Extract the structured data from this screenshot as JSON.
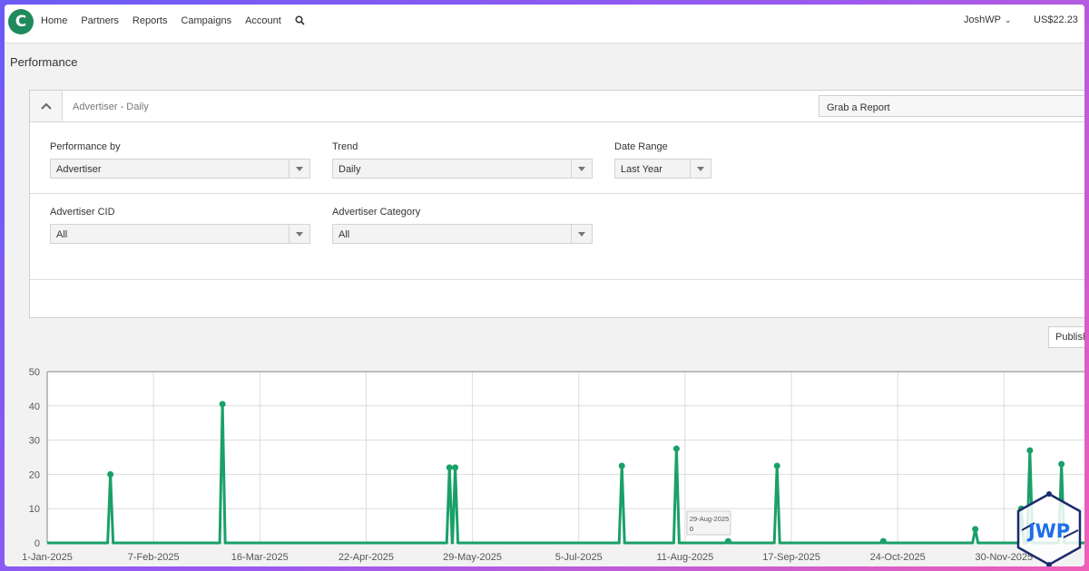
{
  "nav": {
    "links": [
      "Home",
      "Partners",
      "Reports",
      "Campaigns",
      "Account"
    ],
    "user": "JoshWP",
    "balance": "US$22.23",
    "logo_letter": "C"
  },
  "page": {
    "title": "Performance"
  },
  "panel": {
    "title": "Advertiser - Daily",
    "grab_report": "Grab a Report",
    "filters": {
      "performance_by": {
        "label": "Performance by",
        "value": "Advertiser"
      },
      "trend": {
        "label": "Trend",
        "value": "Daily"
      },
      "date_range": {
        "label": "Date Range",
        "value": "Last Year"
      },
      "advertiser_cid": {
        "label": "Advertiser CID",
        "value": "All"
      },
      "advertiser_category": {
        "label": "Advertiser Category",
        "value": "All"
      }
    }
  },
  "publish_label": "Publish",
  "colors": {
    "series": "#1aa068",
    "brand": "#1f8a5b",
    "accent_gradient": [
      "#6a5cf5",
      "#ef5fb8"
    ]
  },
  "watermark": {
    "text": "JWP"
  },
  "chart_data": {
    "type": "line",
    "x_start": "1-Jan-2025",
    "x_end": "28-Dec-2025",
    "xlabel": "",
    "ylabel": "",
    "ylim": [
      0,
      50
    ],
    "yticks": [
      0,
      10,
      20,
      30,
      40,
      50
    ],
    "xticks": [
      "1-Jan-2025",
      "7-Feb-2025",
      "16-Mar-2025",
      "22-Apr-2025",
      "29-May-2025",
      "5-Jul-2025",
      "11-Aug-2025",
      "17-Sep-2025",
      "24-Oct-2025",
      "30-Nov-2025"
    ],
    "grid": true,
    "baseline": 0,
    "series": [
      {
        "points": [
          {
            "x": "23-Jan-2025",
            "y": 20
          },
          {
            "x": "3-Mar-2025",
            "y": 40.5
          },
          {
            "x": "21-May-2025",
            "y": 22
          },
          {
            "x": "23-May-2025",
            "y": 22
          },
          {
            "x": "20-Jul-2025",
            "y": 22.5
          },
          {
            "x": "8-Aug-2025",
            "y": 27.5
          },
          {
            "x": "26-Aug-2025",
            "y": 0.5
          },
          {
            "x": "12-Sep-2025",
            "y": 22.5
          },
          {
            "x": "19-Oct-2025",
            "y": 0.5
          },
          {
            "x": "20-Nov-2025",
            "y": 4
          },
          {
            "x": "6-Dec-2025",
            "y": 10
          },
          {
            "x": "9-Dec-2025",
            "y": 27
          },
          {
            "x": "20-Dec-2025",
            "y": 23
          }
        ]
      }
    ],
    "tooltip": {
      "date": "29-Aug-2025",
      "value": "0"
    }
  }
}
